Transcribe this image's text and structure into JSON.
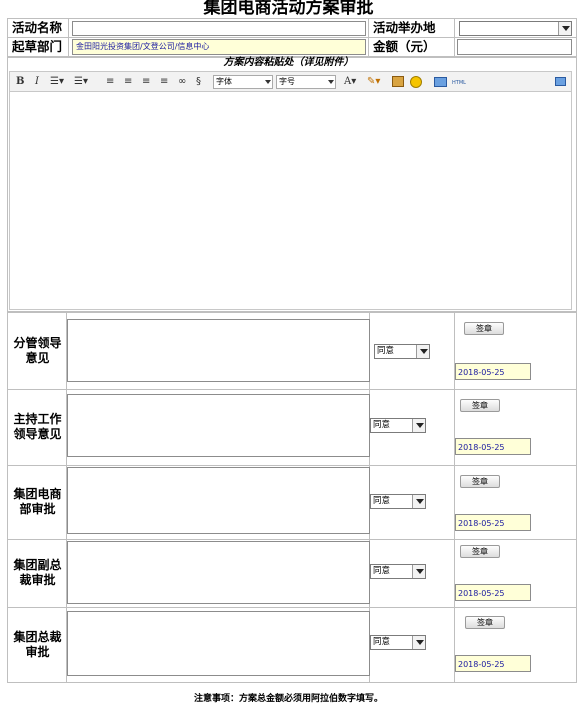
{
  "title": "集团电商活动方案审批",
  "form": {
    "activity_name_label": "活动名称",
    "activity_name_value": "",
    "location_label": "活动举办地",
    "location_value": "",
    "dept_label": "起草部门",
    "dept_value": "金田阳光投资集团/文登公司/信息中心",
    "amount_label": "金额（元）",
    "amount_value": ""
  },
  "editor": {
    "section_label": "方案内容粘贴处（详见附件）",
    "font_family": "字体",
    "font_size": "字号",
    "toolbar_icons": [
      "bold-icon",
      "italic-icon",
      "ordered-list-icon",
      "unordered-list-icon",
      "align-left-icon",
      "align-center-icon",
      "align-right-icon",
      "align-justify-icon",
      "link-icon",
      "unlink-icon",
      "font-color-icon",
      "highlight-icon",
      "image-icon",
      "emoticon-icon",
      "table-icon",
      "html-icon",
      "fullscreen-icon"
    ],
    "html_label": "HTML"
  },
  "approvals": [
    {
      "label": "分管领导意见",
      "decision": "同意",
      "sign": "签章",
      "date": "2018-05-25"
    },
    {
      "label": "主持工作领导意见",
      "decision": "同意",
      "sign": "签章",
      "date": "2018-05-25"
    },
    {
      "label": "集团电商部审批",
      "decision": "同意",
      "sign": "签章",
      "date": "2018-05-25"
    },
    {
      "label": "集团副总裁审批",
      "decision": "同意",
      "sign": "签章",
      "date": "2018-05-25"
    },
    {
      "label": "集团总裁审批",
      "decision": "同意",
      "sign": "签章",
      "date": "2018-05-25"
    }
  ],
  "notice": "注意事项：方案总金额必须用阿拉伯数字填写。"
}
